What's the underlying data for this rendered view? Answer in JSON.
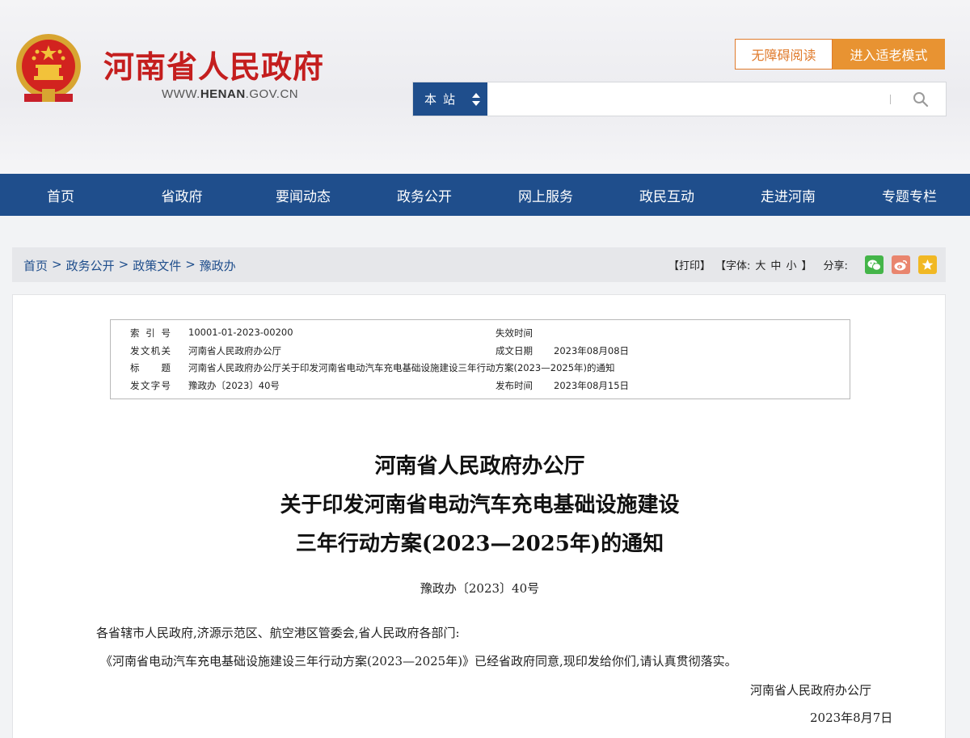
{
  "header": {
    "site_name": "河南省人民政府",
    "site_url_prefix": "WWW.",
    "site_url_main": "HENAN",
    "site_url_suffix": ".GOV.CN",
    "accessible_label": "无障碍阅读",
    "elder_mode_label": "进入适老模式",
    "search_scope": "本站",
    "search_placeholder": ""
  },
  "nav": {
    "items": [
      "首页",
      "省政府",
      "要闻动态",
      "政务公开",
      "网上服务",
      "政民互动",
      "走进河南",
      "专题专栏"
    ]
  },
  "breadcrumb": {
    "items": [
      "首页",
      "政务公开",
      "政策文件",
      "豫政办"
    ],
    "separator": ">"
  },
  "tools": {
    "print": "【打印】",
    "font_label": "【字体:",
    "font_large": "大",
    "font_medium": "中",
    "font_small": "小",
    "font_close": "】",
    "share_label": "分享:",
    "share_icons": [
      "wechat-icon",
      "weibo-icon",
      "favorite-icon"
    ]
  },
  "meta": {
    "index_label": "索引号",
    "index_value": "10001-01-2023-00200",
    "expire_label": "失效时间",
    "expire_value": "",
    "issuer_label": "发文机关",
    "issuer_value": "河南省人民政府办公厅",
    "created_label": "成文日期",
    "created_value": "2023年08月08日",
    "title_label": "标　题",
    "title_value": "河南省人民政府办公厅关于印发河南省电动汽车充电基础设施建设三年行动方案(2023—2025年)的通知",
    "docno_label": "发文字号",
    "docno_value": "豫政办〔2023〕40号",
    "published_label": "发布时间",
    "published_value": "2023年08月15日"
  },
  "document": {
    "title_line1": "河南省人民政府办公厅",
    "title_line2": "关于印发河南省电动汽车充电基础设施建设",
    "title_line3": "三年行动方案(2023—2025年)的通知",
    "number": "豫政办〔2023〕40号",
    "salutation": "各省辖市人民政府,济源示范区、航空港区管委会,省人民政府各部门:",
    "body": "《河南省电动汽车充电基础设施建设三年行动方案(2023—2025年)》已经省政府同意,现印发给你们,请认真贯彻落实。",
    "signer": "河南省人民政府办公厅",
    "date": "2023年8月7日"
  },
  "colors": {
    "brand_blue": "#1f4e8c",
    "brand_red": "#c41e1e",
    "accent_orange": "#e89332"
  }
}
